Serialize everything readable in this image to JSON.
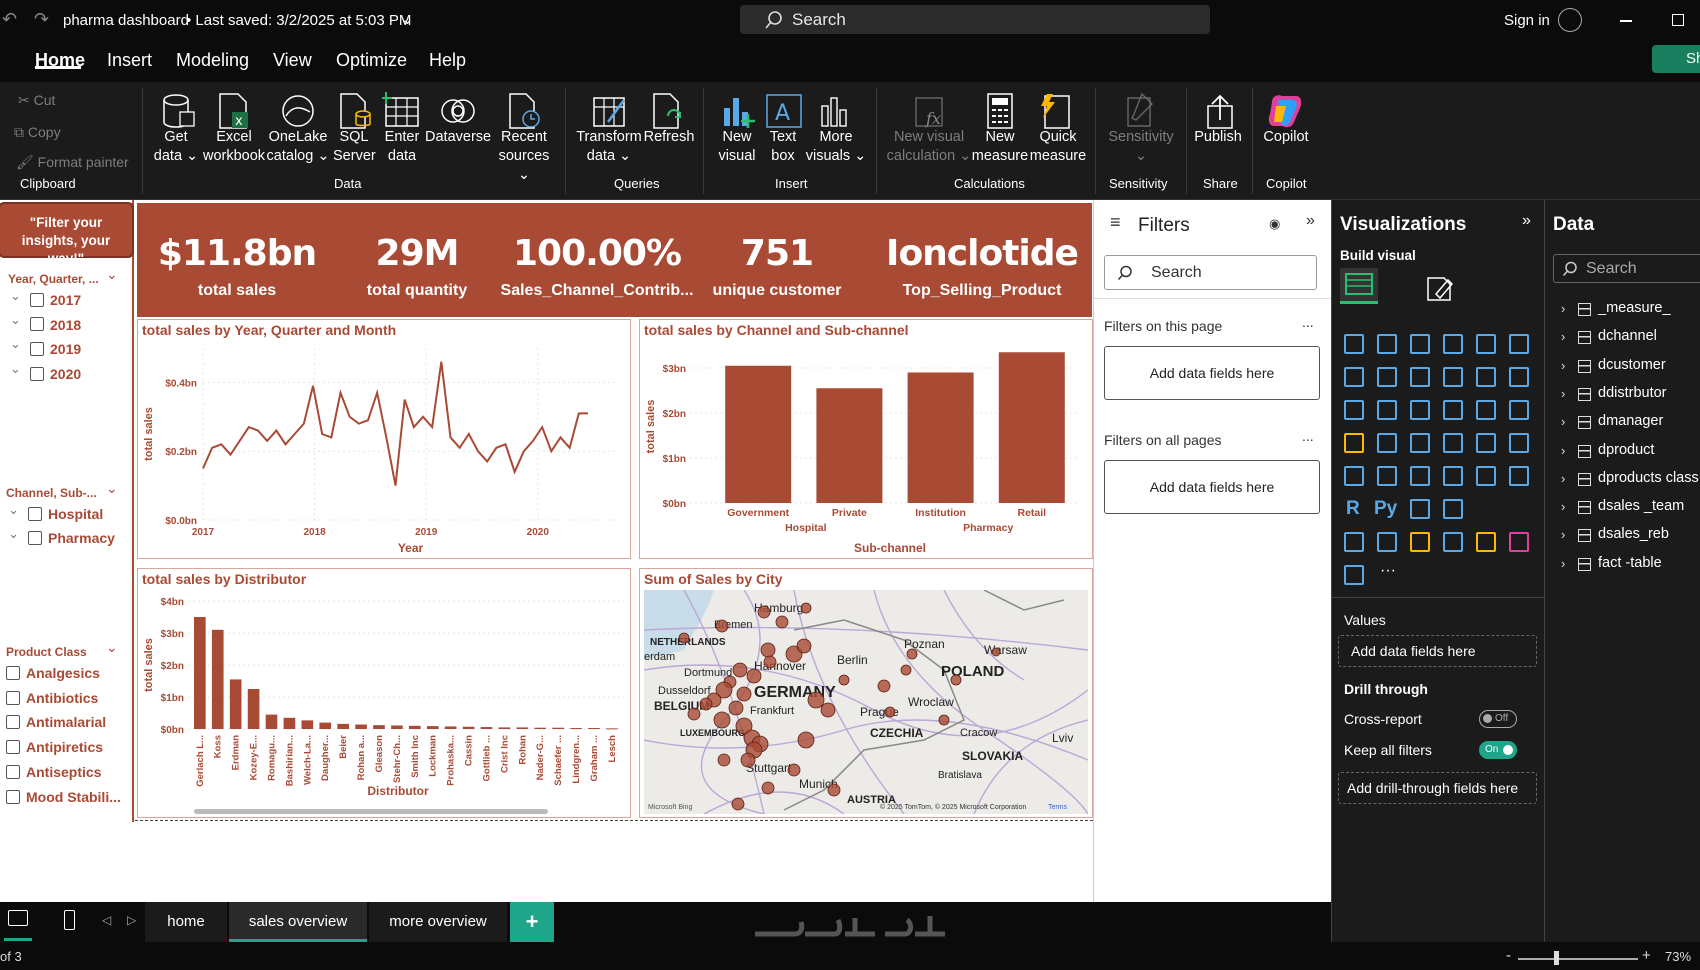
{
  "titlebar": {
    "doc_title": "pharma dashboard",
    "saved": "• Last saved: 3/2/2025 at 5:03 PM",
    "search_placeholder": "Search",
    "sign_in": "Sign in"
  },
  "menu": [
    "Home",
    "Insert",
    "Modeling",
    "View",
    "Optimize",
    "Help"
  ],
  "share_button": "Sh",
  "ribbon": {
    "clipboard": {
      "cut": "Cut",
      "copy": "Copy",
      "format_painter": "Format painter",
      "group": "Clipboard"
    },
    "data_buttons": [
      "Get\ndata ⌄",
      "Excel\nworkbook",
      "OneLake\ncatalog ⌄",
      "SQL\nServer",
      "Enter\ndata",
      "Dataverse",
      "Recent\nsources ⌄"
    ],
    "data_group": "Data",
    "queries_buttons": [
      "Transform\ndata ⌄",
      "Refresh"
    ],
    "queries_group": "Queries",
    "insert_buttons": [
      "New\nvisual",
      "Text\nbox",
      "More\nvisuals ⌄"
    ],
    "insert_group": "Insert",
    "calc_buttons": [
      "New visual\ncalculation ⌄",
      "New\nmeasure",
      "Quick\nmeasure"
    ],
    "calc_group": "Calculations",
    "sensitivity_button": "Sensitivity\n⌄",
    "sensitivity_group": "Sensitivity",
    "publish_button": "Publish",
    "share_group": "Share",
    "copilot_button": "Copilot",
    "copilot_group": "Copilot"
  },
  "slicer": {
    "header": "\"Filter your insights, your way!\"",
    "year_title": "Year, Quarter, ...",
    "years": [
      "2017",
      "2018",
      "2019",
      "2020"
    ],
    "channel_title": "Channel, Sub-...",
    "channels": [
      "Hospital",
      "Pharmacy"
    ],
    "product_title": "Product Class",
    "products": [
      "Analgesics",
      "Antibiotics",
      "Antimalarial",
      "Antipiretics",
      "Antiseptics",
      "Mood Stabili..."
    ]
  },
  "kpis": [
    {
      "value": "$11.8bn",
      "label": "total sales"
    },
    {
      "value": "29M",
      "label": "total quantity"
    },
    {
      "value": "100.00%",
      "label": "Sales_Channel_Contrib..."
    },
    {
      "value": "751",
      "label": "unique customer"
    },
    {
      "value": "Ionclotide",
      "label": "Top_Selling_Product"
    }
  ],
  "chart_data": [
    {
      "type": "line",
      "title": "total sales by Year, Quarter and Month",
      "xlabel": "Year",
      "ylabel": "total sales",
      "x_ticks": [
        "2017",
        "2018",
        "2019",
        "2020"
      ],
      "y_ticks": [
        "$0.0bn",
        "$0.2bn",
        "$0.4bn"
      ],
      "ylim": [
        0,
        0.5
      ],
      "values": [
        0.15,
        0.21,
        0.22,
        0.19,
        0.23,
        0.27,
        0.26,
        0.23,
        0.26,
        0.22,
        0.25,
        0.28,
        0.39,
        0.25,
        0.24,
        0.37,
        0.3,
        0.28,
        0.29,
        0.37,
        0.24,
        0.1,
        0.35,
        0.27,
        0.3,
        0.27,
        0.46,
        0.24,
        0.21,
        0.25,
        0.2,
        0.17,
        0.21,
        0.22,
        0.14,
        0.2,
        0.23,
        0.27,
        0.2,
        0.24,
        0.21,
        0.31,
        0.31
      ]
    },
    {
      "type": "bar",
      "title": "total sales by Channel and Sub-channel",
      "xlabel": "Sub-channel",
      "ylabel": "total sales",
      "categories": [
        "Government",
        "Private",
        "Institution",
        "Retail"
      ],
      "groups": [
        "Hospital",
        "Pharmacy"
      ],
      "y_ticks": [
        "$0bn",
        "$1bn",
        "$2bn",
        "$3bn"
      ],
      "ylim": [
        0,
        3.4
      ],
      "values": [
        3.05,
        2.55,
        2.9,
        3.35
      ]
    },
    {
      "type": "bar",
      "title": "total sales by Distributor",
      "xlabel": "Distributor",
      "ylabel": "total sales",
      "y_ticks": [
        "$0bn",
        "$1bn",
        "$2bn",
        "$3bn",
        "$4bn"
      ],
      "ylim": [
        0,
        4
      ],
      "categories": [
        "Gerlach L...",
        "Koss",
        "Erdman",
        "Kozey-E...",
        "Romagu...",
        "Bashirian...",
        "Welch-La...",
        "Daugher...",
        "Beier",
        "Rohan a...",
        "Gleason",
        "Stehr-Ch...",
        "Smith Inc",
        "Lockman",
        "Prohaska...",
        "Cassin",
        "Gottlieb ...",
        "Crist Inc",
        "Rohan",
        "Nader-G...",
        "Schaefer ...",
        "Lindgren...",
        "Graham ...",
        "Lesch"
      ],
      "values": [
        3.5,
        3.1,
        1.55,
        1.25,
        0.45,
        0.35,
        0.27,
        0.2,
        0.16,
        0.14,
        0.12,
        0.11,
        0.1,
        0.09,
        0.08,
        0.07,
        0.06,
        0.05,
        0.05,
        0.04,
        0.04,
        0.03,
        0.03,
        0.02
      ]
    }
  ],
  "map": {
    "title": "Sum of Sales by City",
    "labels": [
      "NETHERLANDS",
      "Bremen",
      "Hamburg",
      "Poznan",
      "Warsaw",
      "Berlin",
      "POLAND",
      "erdam",
      "Dortmund",
      "Dusseldorf",
      "Hannover",
      "GERMANY",
      "BELGIUM",
      "Frankfurt",
      "Prague",
      "Wroclaw",
      "LUXEMBOURG",
      "CZECHIA",
      "Cracow",
      "Lviv",
      "SLOVAKIA",
      "Stuttgart",
      "Munich",
      "Bratislava",
      "AUSTRIA"
    ],
    "copyright": "© 2025 TomTom, © 2025 Microsoft Corporation",
    "terms": "Terms",
    "bing": "Microsoft Bing"
  },
  "filters": {
    "title": "Filters",
    "search": "Search",
    "on_page": "Filters on this page",
    "on_all": "Filters on all pages",
    "add_fields": "Add data fields here",
    "more": "..."
  },
  "viz": {
    "title": "Visualizations",
    "build": "Build visual",
    "values": "Values",
    "add_values": "Add data fields here",
    "drill": "Drill through",
    "cross_report": "Cross-report",
    "off": "Off",
    "keep_filters": "Keep all filters",
    "on": "On",
    "add_drill": "Add drill-through fields here",
    "r": "R",
    "py": "Py",
    "more": "···"
  },
  "data": {
    "title": "Data",
    "search": "Search",
    "tables": [
      "_measure_",
      "dchannel",
      "dcustomer",
      "ddistrbutor",
      "dmanager",
      "dproduct",
      "dproducts class",
      "dsales _team",
      "dsales_reb",
      "fact -table"
    ]
  },
  "tabs": [
    "home",
    "sales overview",
    "more overview"
  ],
  "status": {
    "page": "of 3",
    "zoom": "73%",
    "minus": "-",
    "plus": "+"
  },
  "colors": {
    "accent": "#a94a35",
    "teal": "#1fa68a"
  }
}
